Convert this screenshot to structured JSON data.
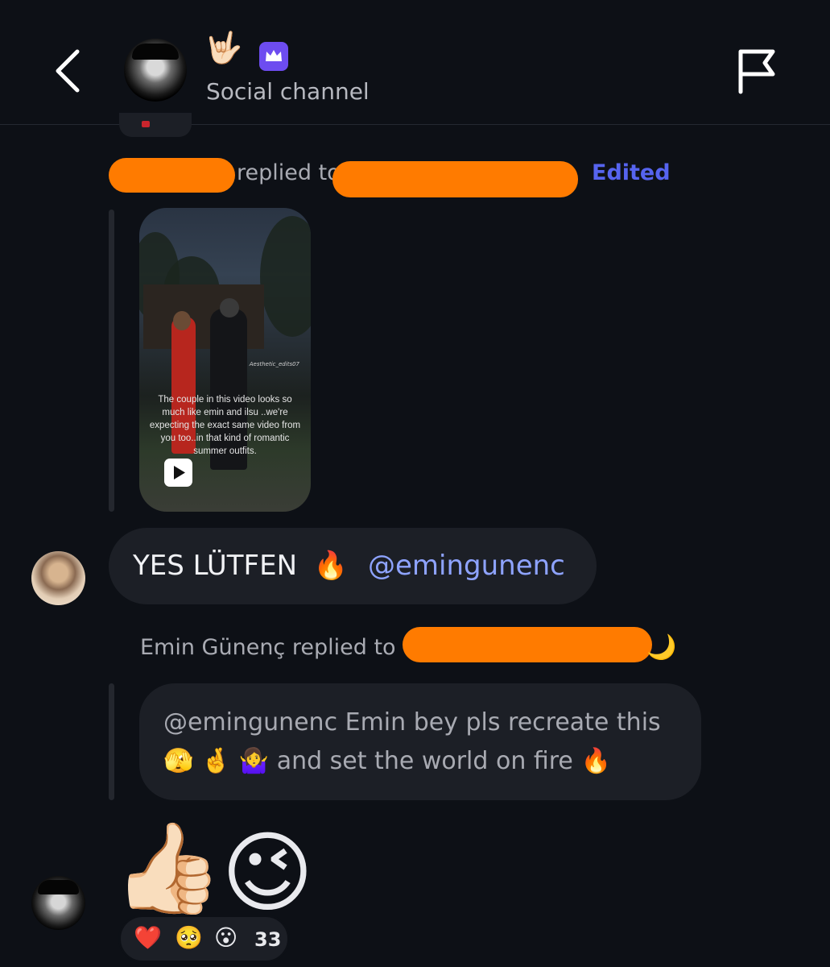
{
  "header": {
    "channel_name": "Social channel",
    "title_emoji": "🤟🏻",
    "back_icon": "chevron-left-icon",
    "crown_icon": "crown-icon",
    "flag_icon": "flag-icon",
    "badge_color": "#6d4cf0"
  },
  "reply_1": {
    "label": "replied to",
    "edited": "Edited"
  },
  "video": {
    "caption": "The  couple in this video looks so much like emin and ilsu ..we're expecting the exact same video from you too..in that kind of romantic summer outfits.",
    "watermark": "Aesthetic_edits07"
  },
  "message_1": {
    "text": "YES LÜTFEN",
    "emoji": "🔥",
    "mention": "@emingunenc"
  },
  "reply_2": {
    "label": "Emin Günenç replied to",
    "trailing_emoji": "🌙"
  },
  "quoted_message": {
    "mention": "@emingunenc",
    "line_1": "Emin bey pls recreate this",
    "emojis": "🫣 🤞 🤷‍♀️",
    "line_2": "and set the world on fire",
    "fire": "🔥"
  },
  "message_2": {
    "emoji_1": "👍🏻",
    "emoji_2": "😉"
  },
  "reactions": {
    "heart": "❤️",
    "pleading": "🥺",
    "surprised": "😮",
    "count": "33"
  },
  "colors": {
    "background": "#0d1016",
    "bubble": "#1c1f26",
    "mention": "#8ea3ff",
    "edited": "#5664ef",
    "redaction": "#ff7b00"
  }
}
